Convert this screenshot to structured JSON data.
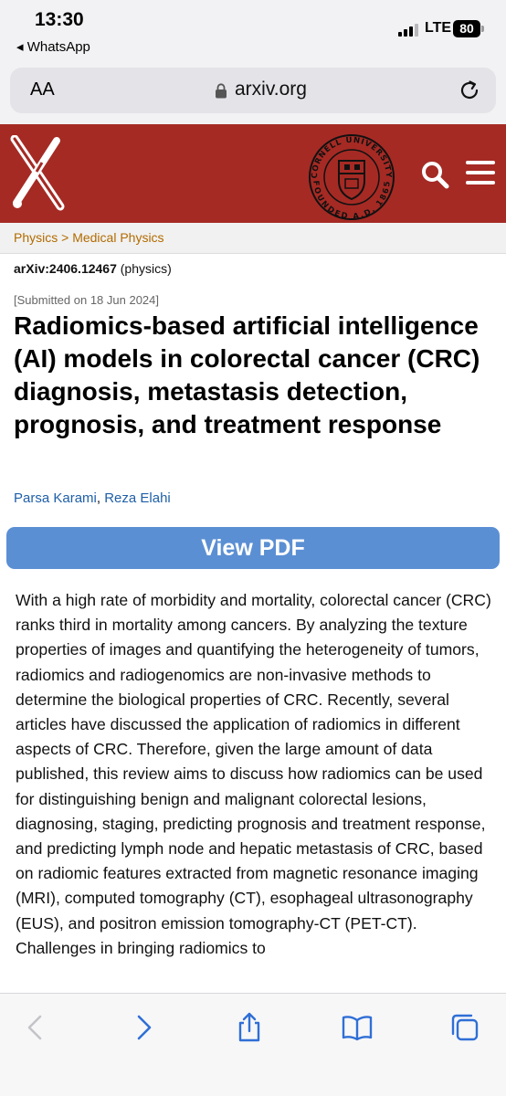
{
  "status_bar": {
    "time": "13:30",
    "back_app": "◂ WhatsApp",
    "network": "LTE",
    "battery": "80"
  },
  "url_bar": {
    "text_size_label": "AA",
    "url": "arxiv.org"
  },
  "header": {
    "brand_color": "#a52a24",
    "seal_text_top": "CORNELL UNIVERSITY",
    "seal_text_bottom": "FOUNDED A.D. 1865"
  },
  "breadcrumb": "Physics > Medical Physics",
  "paper": {
    "arxiv_id": "arXiv:2406.12467",
    "category": "(physics)",
    "submitted": "[Submitted on 18 Jun 2024]",
    "title": "Radiomics-based artificial intelligence (AI) models in colorectal cancer (CRC) diagnosis, metastasis detection, prognosis, and treatment response",
    "authors": [
      "Parsa Karami",
      "Reza Elahi"
    ],
    "author_separator": ", ",
    "view_pdf_label": "View PDF",
    "abstract": "With a high rate of morbidity and mortality, colorectal cancer (CRC) ranks third in mortality among cancers. By analyzing the texture properties of images and quantifying the heterogeneity of tumors, radiomics and radiogenomics are non-invasive methods to determine the biological properties of CRC. Recently, several articles have discussed the application of radiomics in different aspects of CRC. Therefore, given the large amount of data published, this review aims to discuss how radiomics can be used for distinguishing benign and malignant colorectal lesions, diagnosing, staging, predicting prognosis and treatment response, and predicting lymph node and hepatic metastasis of CRC, based on radiomic features extracted from magnetic resonance imaging (MRI), computed tomography (CT), esophageal ultrasonography (EUS), and positron emission tomography-CT (PET-CT). Challenges in bringing radiomics to"
  },
  "toolbar": {
    "icons": [
      "back-icon",
      "forward-icon",
      "share-icon",
      "bookmarks-icon",
      "tabs-icon"
    ]
  }
}
